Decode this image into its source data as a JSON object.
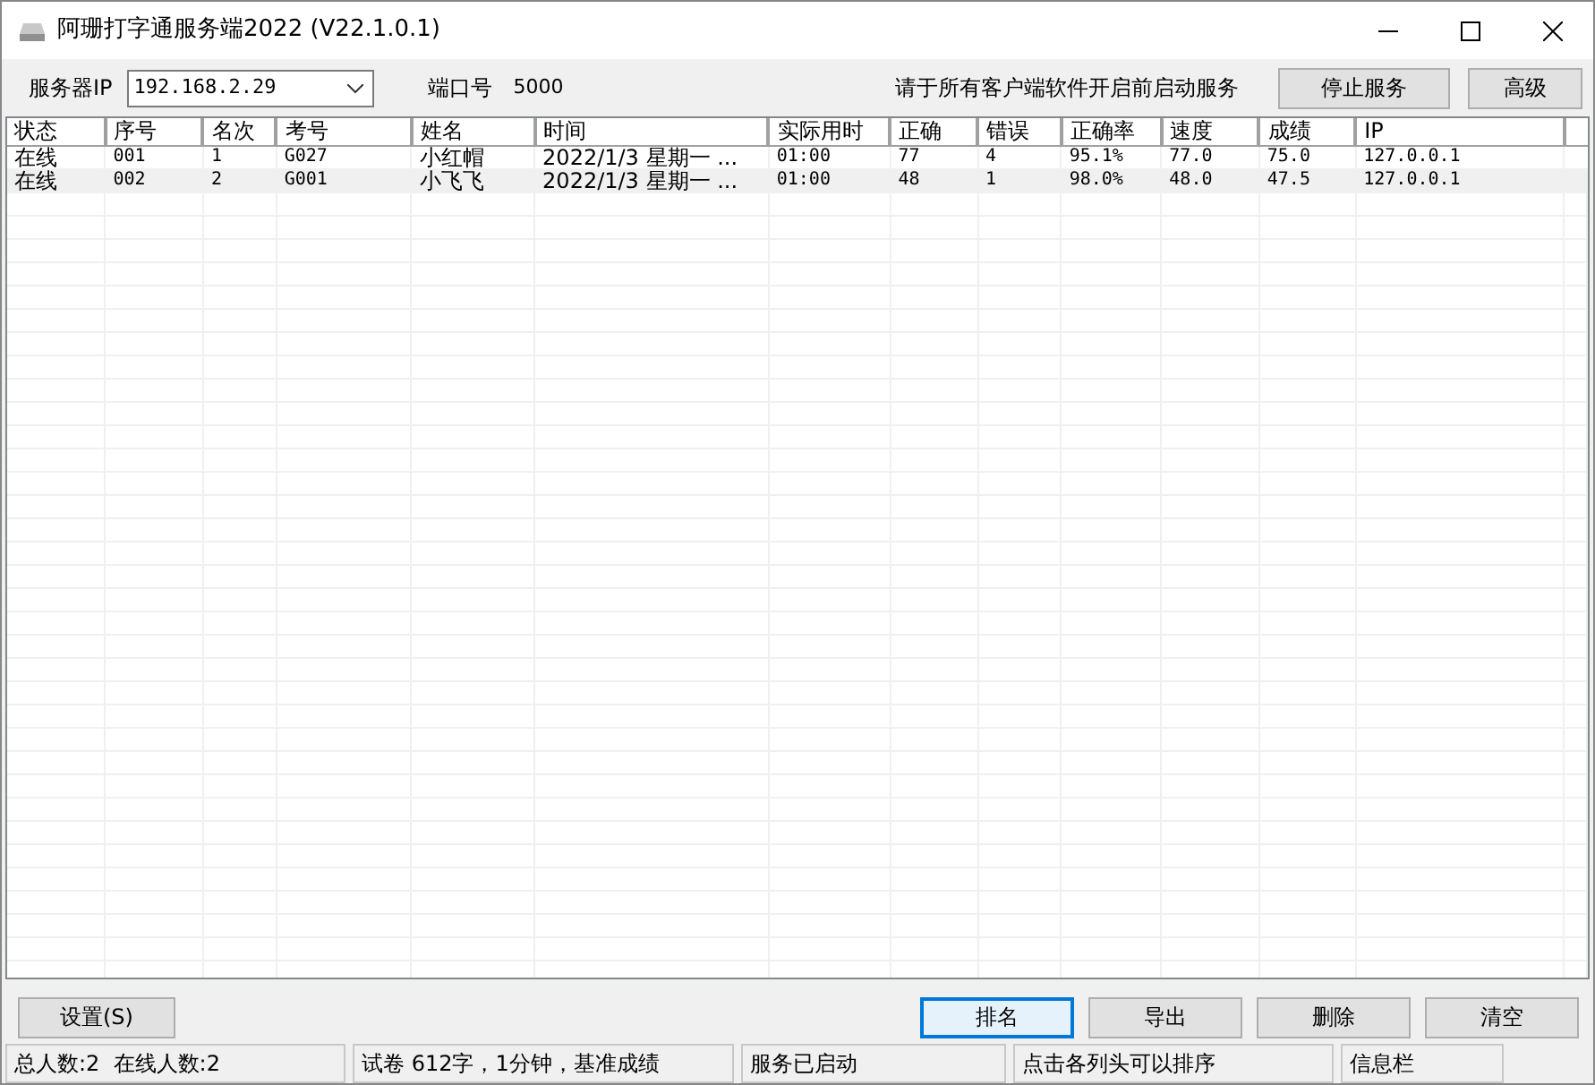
{
  "window": {
    "title": "阿珊打字通服务端2022 (V22.1.0.1)"
  },
  "toolbar": {
    "server_ip_label": "服务器IP",
    "server_ip": "192.168.2.29",
    "port_label": "端口号",
    "port": "5000",
    "notice": "请于所有客户端软件开启前启动服务",
    "buttons": [
      "停止服务",
      "高级"
    ]
  },
  "table": {
    "columns": [
      "状态",
      "序号",
      "名次",
      "考号",
      "姓名",
      "时间",
      "实际用时",
      "正确",
      "错误",
      "正确率",
      "速度",
      "成绩",
      "IP"
    ],
    "rows": [
      {
        "cells": [
          "在线",
          "001",
          "1",
          "G027",
          "小红帽",
          "2022/1/3 星期一 ...",
          "01:00",
          "77",
          "4",
          "95.1%",
          "77.0",
          "75.0",
          "127.0.0.1"
        ]
      },
      {
        "cells": [
          "在线",
          "002",
          "2",
          "G001",
          "小飞飞",
          "2022/1/3 星期一 ...",
          "01:00",
          "48",
          "1",
          "98.0%",
          "48.0",
          "47.5",
          "127.0.0.1"
        ]
      }
    ]
  },
  "left_button": {
    "label": "设置(S)"
  },
  "buttons": [
    {
      "label": "排名",
      "focused": true
    },
    {
      "label": "导出",
      "focused": false
    },
    {
      "label": "删除",
      "focused": false
    },
    {
      "label": "清空",
      "focused": false
    }
  ],
  "status_bar": [
    "总人数:2  在线人数:2",
    "试卷 612字，1分钟，基准成绩",
    "服务已启动",
    "点击各列头可以排序",
    "信息栏"
  ]
}
